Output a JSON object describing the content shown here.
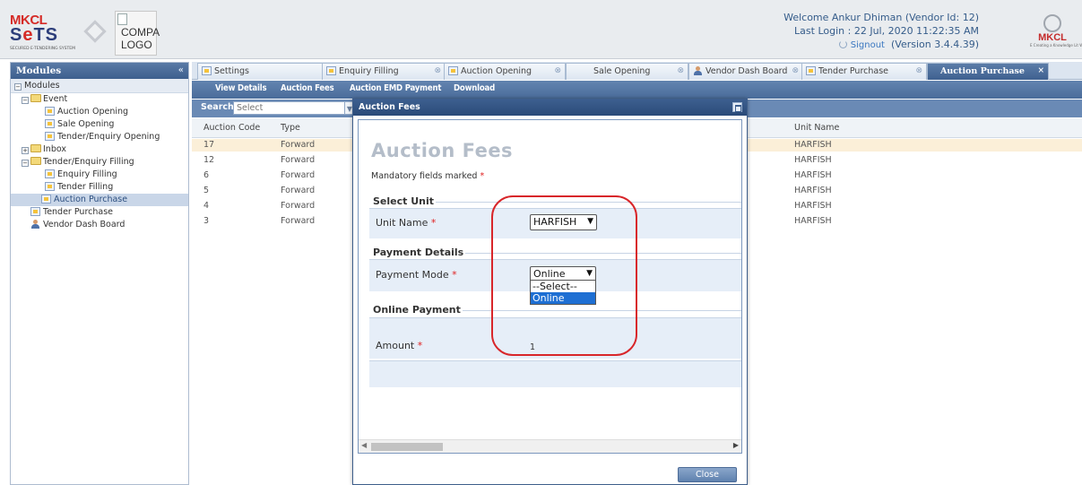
{
  "header": {
    "brand_mkcl": "MKCL",
    "brand_sets_a": "S",
    "brand_sets_b": "e",
    "brand_sets_c": "TS",
    "brand_tagline": "SECURED E-TENDERING SYSTEM",
    "company_logo_alt": "COMPA LOGO",
    "welcome_text": "Welcome Ankur Dhiman (Vendor Id: 12)",
    "last_login": "Last Login : 22 Jul, 2020 11:22:35 AM",
    "signout_label": "Signout",
    "version": "(Version 3.4.4.39)",
    "right_logo_text": "MKCL",
    "right_logo_tagline": "E Creating a Knowledge Lit World"
  },
  "left_panel": {
    "title": "Modules",
    "collapse_icon": "double-chevron-left-icon",
    "tree": [
      {
        "label": "Modules",
        "level": 0,
        "kind": "root"
      },
      {
        "label": "Event",
        "level": 1,
        "kind": "folder",
        "expanded": true
      },
      {
        "label": "Auction Opening",
        "level": 2,
        "kind": "page"
      },
      {
        "label": "Sale Opening",
        "level": 2,
        "kind": "page"
      },
      {
        "label": "Tender/Enquiry Opening",
        "level": 2,
        "kind": "page"
      },
      {
        "label": "Inbox",
        "level": 1,
        "kind": "folder",
        "expanded": false
      },
      {
        "label": "Tender/Enquiry Filling",
        "level": 1,
        "kind": "folder",
        "expanded": true
      },
      {
        "label": "Enquiry Filling",
        "level": 2,
        "kind": "page"
      },
      {
        "label": "Tender Filling",
        "level": 2,
        "kind": "page"
      },
      {
        "label": "Auction Purchase",
        "level": 1,
        "kind": "page",
        "selected": true
      },
      {
        "label": "Tender Purchase",
        "level": 1,
        "kind": "page"
      },
      {
        "label": "Vendor Dash Board",
        "level": 1,
        "kind": "person"
      }
    ]
  },
  "tabs": [
    {
      "label": "Settings"
    },
    {
      "label": "Enquiry Filling"
    },
    {
      "label": "Auction Opening"
    },
    {
      "label": "Sale Opening"
    },
    {
      "label": "Vendor Dash Board"
    },
    {
      "label": "Tender Purchase"
    },
    {
      "label": "Auction Purchase",
      "active": true
    }
  ],
  "toolbar": {
    "view_details": "View Details",
    "auction_fees": "Auction Fees",
    "auction_emd_payment": "Auction EMD Payment",
    "download": "Download"
  },
  "search": {
    "label": "Search :",
    "placeholder": "Select"
  },
  "grid": {
    "columns": [
      "Auction Code",
      "Type",
      "Unit Name"
    ],
    "rows": [
      [
        "17",
        "Forward",
        "HARFISH"
      ],
      [
        "12",
        "Forward",
        "HARFISH"
      ],
      [
        "6",
        "Forward",
        "HARFISH"
      ],
      [
        "5",
        "Forward",
        "HARFISH"
      ],
      [
        "4",
        "Forward",
        "HARFISH"
      ],
      [
        "3",
        "Forward",
        "HARFISH"
      ]
    ]
  },
  "modal": {
    "title": "Auction Fees",
    "heading": "Auction Fees",
    "mandatory_note": "Mandatory fields marked",
    "required_mark": "*",
    "section_unit": "Select Unit",
    "unit_label": "Unit Name",
    "unit_value": "HARFISH",
    "section_payment": "Payment Details",
    "payment_mode_label": "Payment Mode",
    "payment_mode_value": "Online",
    "payment_mode_options": [
      "--Select--",
      "Online"
    ],
    "section_online": "Online Payment",
    "amount_label": "Amount",
    "amount_value": "1",
    "close_label": "Close"
  },
  "colors": {
    "annotation": "#d8262a",
    "header_blue": "#3d5f8e",
    "highlight": "#1e6fd3"
  }
}
